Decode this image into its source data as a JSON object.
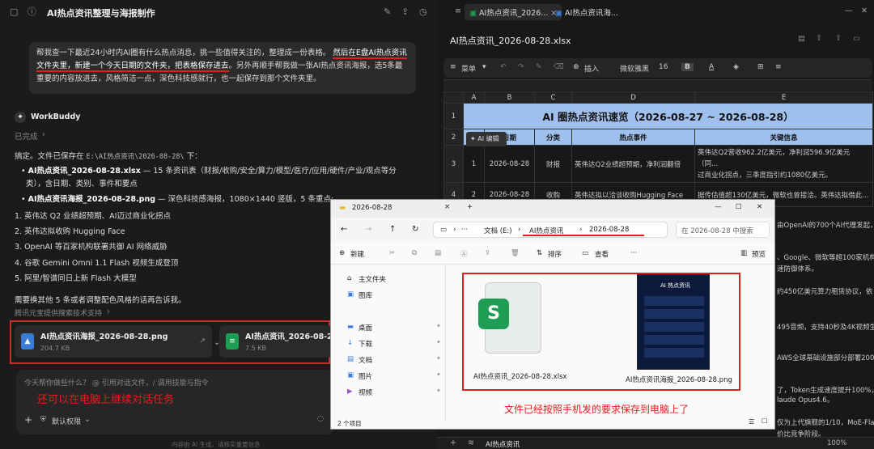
{
  "chat": {
    "title": "AI热点资讯整理与海报制作",
    "user_message_a": "帮我查一下最近24小时内AI圈有什么热点消息，挑一些值得关注的，整理成一份表格。",
    "user_message_b": "然后在E盘AI热点资讯",
    "user_message_c": "文件夹里，新建一个今天日期的文件夹，把表格保存进去",
    "user_message_d": "。另外再顺手帮我做一张AI热点资讯海报，选5条最",
    "user_message_e": "重要的内容放进去，风格简洁一点，深色科技感就行，也一起保存到那个文件夹里。",
    "assistant_name": "WorkBuddy",
    "status": "已完成",
    "intro": "搞定。文件已保存在",
    "path": "E:\\AI热点资讯\\2026-08-28\\",
    "intro_suffix": "下：",
    "file1_name": "AI热点资讯_2026-08-28.xlsx",
    "file1_desc": " — 15 条资讯表（财报/收购/安全/算力/模型/医疗/应用/硬件/产业/观点等分",
    "file1_desc2": "类），含日期、类别、事件和要点",
    "file2_name": "AI热点资讯海报_2026-08-28.png",
    "file2_desc": " — 深色科技感海报，1080×1440 竖版，5 条重点:",
    "points": [
      "1. 英伟达 Q2 业绩超预期、AI迈过商业化拐点",
      "2. 英伟达拟收购 Hugging Face",
      "3. OpenAI 等百家机构联署共御 AI 网络威胁",
      "4. 谷歌 Gemini Omni 1.1 Flash 视频生成登顶",
      "5. 阿里/智谱同日上新 Flash 大模型"
    ],
    "followup": "需要换其他 5 条或者调整配色风格的话再告诉我。",
    "source": "腾讯元宝提供搜索技术支持",
    "card1_name": "AI热点资讯海报_2026-08-28.png",
    "card1_size": "204.7 KB",
    "card2_name": "AI热点资讯_2026-08-28",
    "card2_size": "7.5 KB",
    "input_placeholder": "今天帮你做些什么？ @ 引用对话文件，/ 调用技能与指令",
    "annotation_left": "还可以在电脑上继续对话任务",
    "permission": "默认权限",
    "footer": "内容由 AI 生成，请核实重要信息"
  },
  "sheet": {
    "tab1": "AI热点资讯_2026...",
    "tab2": "AI热点资讯海...",
    "filename": "AI热点资讯_2026-08-28.xlsx",
    "menu": "菜单",
    "insert": "插入",
    "font": "微软雅黑",
    "font_size": "16",
    "col_headers": [
      "A",
      "B",
      "C",
      "D",
      "E"
    ],
    "sheet_title": "AI 圈热点资讯速览（2026-08-27 ~ 2026-08-28）",
    "headers": [
      "序号",
      "日期",
      "分类",
      "热点事件",
      "关键信息"
    ],
    "ai_edit": "AI 编辑",
    "rows": [
      {
        "n": "1",
        "date": "2026-08-28",
        "cat": "财报",
        "event": "英伟达Q2业绩超预期，净利润翻倍",
        "info": "英伟达Q2营收962.2亿美元，净利润596.9亿美元（同..."
      },
      {
        "n": "2",
        "date": "2026-08-28",
        "cat": "收购",
        "event": "英伟达拟以洽谈收购Hugging Face",
        "info": "据传估值超130亿美元，微软也曾接洽。英伟达拟借此..."
      }
    ],
    "info_line1b": "过商业化拐点，三季度指引约1080亿美元。",
    "side_snips": [
      "由OpenAI的700个AI代理发起，",
      "、Google、微软等超100家机构联",
      "速防御体系。",
      "约450亿美元算力租赁协议，依",
      "495音频，支持40秒及4K视频生",
      "AWS全球基础设施部分部署200",
      "了，Token生成速度提升100%，适",
      "laude Opus4.6。",
      "仅为上代旗舰的1/10，MoE-Fla",
      "价比竞争阶段。"
    ],
    "sheet_tab": "AI热点资讯",
    "zoom": "100%"
  },
  "explorer": {
    "window_title": "2026-08-28",
    "crumbs": [
      "文档 (E:)",
      "AI热点资讯",
      "2026-08-28"
    ],
    "search_placeholder": "在 2026-08-28 中搜索",
    "new": "新建",
    "sort": "排序",
    "view": "查看",
    "preview": "预览",
    "nav_items": [
      "主文件夹",
      "图库",
      "桌面",
      "下载",
      "文档",
      "图片",
      "视频"
    ],
    "file1": "AI热点资讯_2026-08-28.xlsx",
    "file2": "AI热点资讯海报_2026-08-28.png",
    "poster_title": "AI 热点资讯",
    "count": "2 个项目",
    "annotation": "文件已经按照手机发的要求保存到电脑上了"
  }
}
